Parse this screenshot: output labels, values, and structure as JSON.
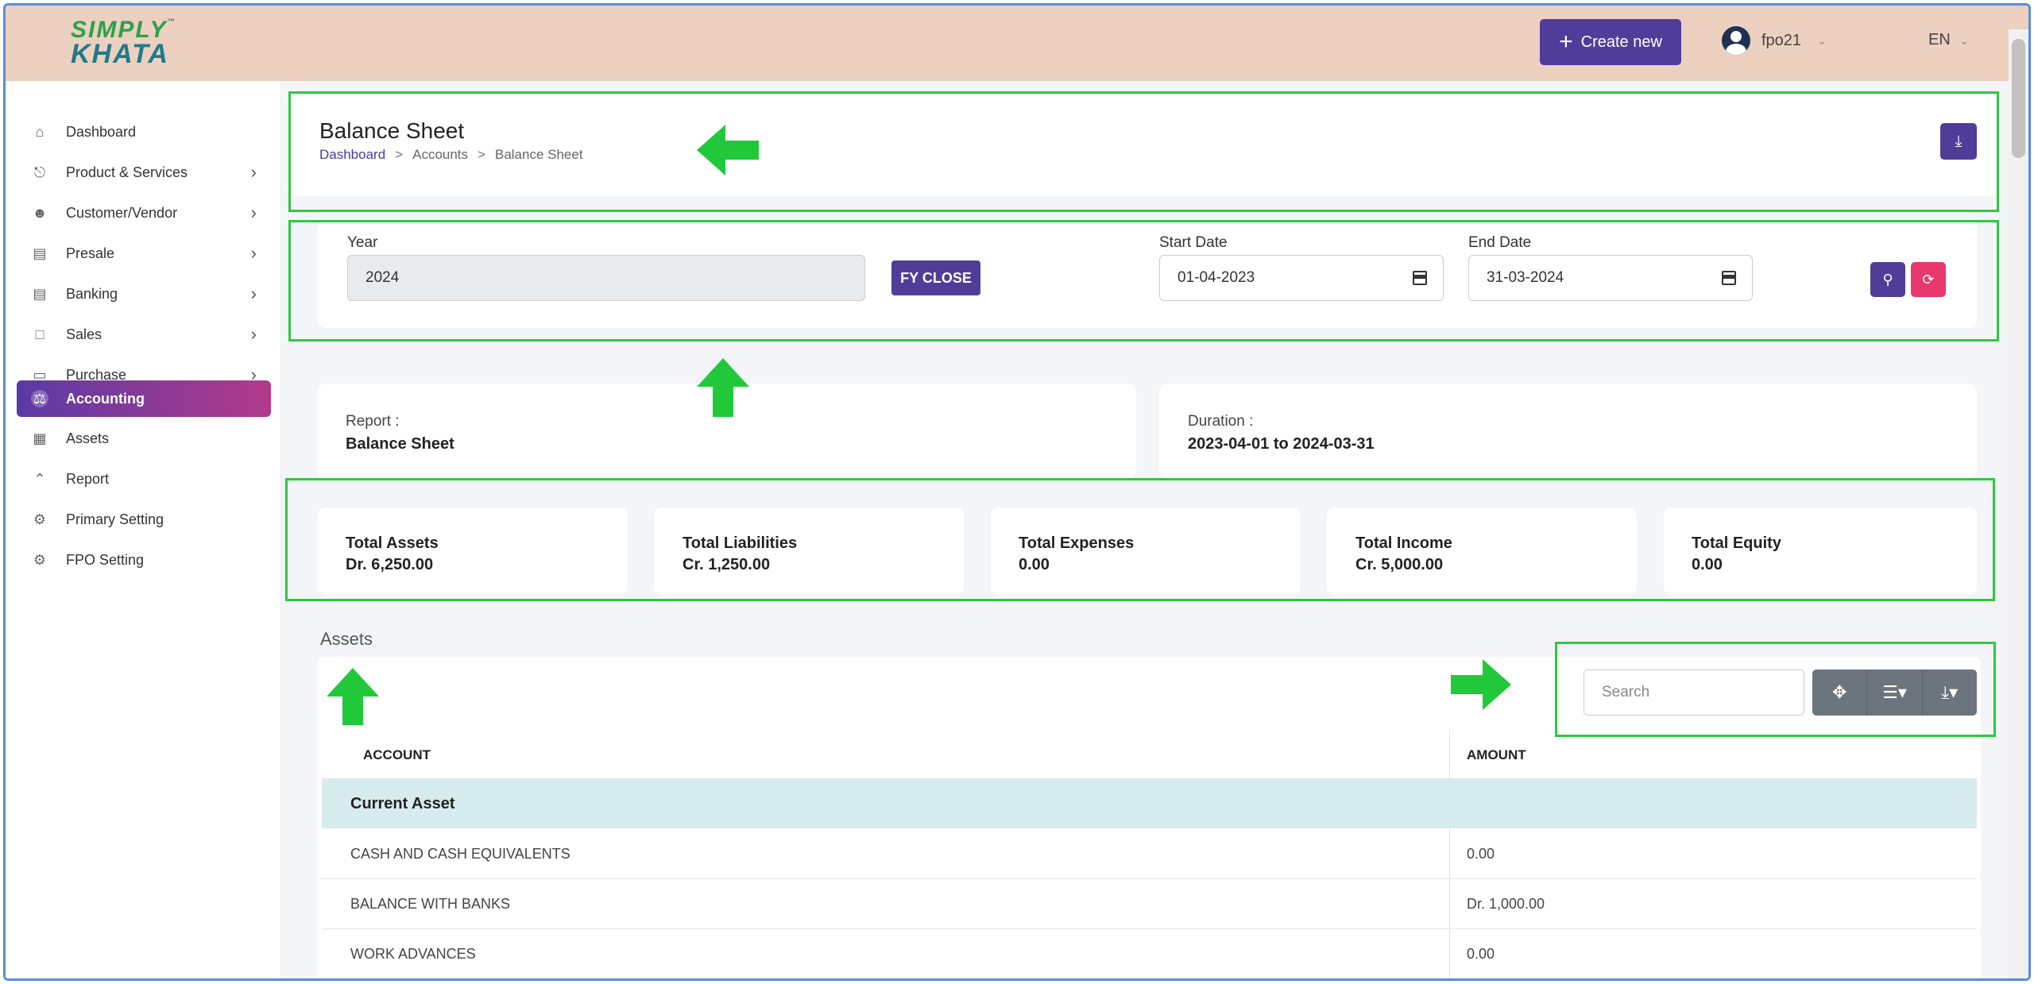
{
  "header": {
    "logo_line1": "SIMPLY",
    "logo_line2": "KHATA",
    "logo_tm": "™",
    "create_label": "Create new",
    "user_name": "fpo21",
    "language": "EN"
  },
  "sidebar": {
    "items": [
      {
        "label": "Dashboard",
        "icon": "home-icon"
      },
      {
        "label": "Product & Services",
        "icon": "cart-icon"
      },
      {
        "label": "Customer/Vendor",
        "icon": "user-plus-icon"
      },
      {
        "label": "Presale",
        "icon": "bank-icon"
      },
      {
        "label": "Banking",
        "icon": "bank-icon"
      },
      {
        "label": "Sales",
        "icon": "document-icon"
      },
      {
        "label": "Purchase",
        "icon": "clipboard-icon"
      },
      {
        "label": "Accounting",
        "icon": "scale-icon"
      },
      {
        "label": "Assets",
        "icon": "calculator-icon"
      },
      {
        "label": "Report",
        "icon": "chart-icon"
      },
      {
        "label": "Primary Setting",
        "icon": "settings-icon"
      },
      {
        "label": "FPO Setting",
        "icon": "gear-icon"
      }
    ]
  },
  "page": {
    "title": "Balance Sheet",
    "breadcrumb": [
      "Dashboard",
      "Accounts",
      "Balance Sheet"
    ]
  },
  "filters": {
    "year_label": "Year",
    "year_value": "2024",
    "fy_close_label": "FY CLOSE",
    "start_label": "Start Date",
    "start_value": "01-04-2023",
    "end_label": "End Date",
    "end_value": "31-03-2024"
  },
  "info": {
    "report_label": "Report :",
    "report_value": "Balance Sheet",
    "duration_label": "Duration :",
    "duration_value": "2023-04-01 to 2024-03-31"
  },
  "stats": [
    {
      "label": "Total Assets",
      "value": "Dr. 6,250.00"
    },
    {
      "label": "Total Liabilities",
      "value": "Cr. 1,250.00"
    },
    {
      "label": "Total Expenses",
      "value": "0.00"
    },
    {
      "label": "Total Income",
      "value": "Cr. 5,000.00"
    },
    {
      "label": "Total Equity",
      "value": "0.00"
    }
  ],
  "assets": {
    "section_title": "Assets",
    "search_placeholder": "Search",
    "columns": [
      "ACCOUNT",
      "AMOUNT"
    ],
    "group_label": "Current Asset",
    "rows": [
      {
        "account": "CASH AND CASH EQUIVALENTS",
        "amount": "0.00"
      },
      {
        "account": "BALANCE WITH BANKS",
        "amount": "Dr. 1,000.00"
      },
      {
        "account": "WORK ADVANCES",
        "amount": "0.00"
      }
    ]
  },
  "colors": {
    "primary": "#503d99",
    "reset": "#e8386d",
    "highlight": "#2ec940",
    "header_bg": "#ecd0c0"
  }
}
